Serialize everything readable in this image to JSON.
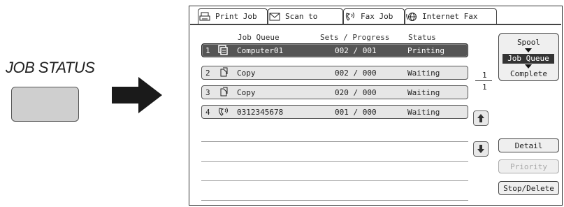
{
  "left": {
    "label": "JOB STATUS"
  },
  "tabs": [
    {
      "label": "Print Job",
      "icon": "printer-icon"
    },
    {
      "label": "Scan to",
      "icon": "scan-icon"
    },
    {
      "label": "Fax Job",
      "icon": "fax-icon"
    },
    {
      "label": "Internet Fax",
      "icon": "internet-fax-icon"
    }
  ],
  "table": {
    "headers": {
      "queue": "Job Queue",
      "sets": "Sets / Progress",
      "status": "Status"
    },
    "rows": [
      {
        "num": "1",
        "icon": "computer-icon",
        "name": "Computer01",
        "progress": "002 / 001",
        "status": "Printing"
      },
      {
        "num": "2",
        "icon": "copy-icon",
        "name": "Copy",
        "progress": "002 / 000",
        "status": "Waiting"
      },
      {
        "num": "3",
        "icon": "copy-icon",
        "name": "Copy",
        "progress": "020 / 000",
        "status": "Waiting"
      },
      {
        "num": "4",
        "icon": "fax-phone-icon",
        "name": "0312345678",
        "progress": "001 / 000",
        "status": "Waiting"
      }
    ]
  },
  "pager": {
    "current": "1",
    "total": "1"
  },
  "side": {
    "spool": "Spool",
    "job_queue": "Job Queue",
    "complete": "Complete",
    "detail": "Detail",
    "priority": "Priority",
    "stop_delete": "Stop/Delete"
  }
}
